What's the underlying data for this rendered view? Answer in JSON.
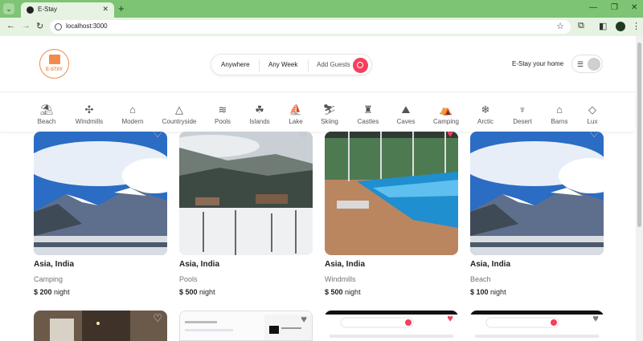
{
  "browser": {
    "tab_title": "E-Stay",
    "url": "localhost:3000"
  },
  "header": {
    "logo_text": "E-STAY",
    "search": {
      "anywhere": "Anywhere",
      "any_week": "Any Week",
      "add_guests": "Add Guests"
    },
    "host_link": "E-Stay your home"
  },
  "categories": [
    {
      "label": "Beach",
      "icon": "beach-icon"
    },
    {
      "label": "Windmills",
      "icon": "windmill-icon"
    },
    {
      "label": "Modern",
      "icon": "modern-house-icon"
    },
    {
      "label": "Countryside",
      "icon": "mountain-icon"
    },
    {
      "label": "Pools",
      "icon": "pool-icon"
    },
    {
      "label": "Islands",
      "icon": "island-icon"
    },
    {
      "label": "Lake",
      "icon": "sailboat-icon"
    },
    {
      "label": "Skiing",
      "icon": "skiing-icon"
    },
    {
      "label": "Castles",
      "icon": "castle-icon"
    },
    {
      "label": "Caves",
      "icon": "cave-icon"
    },
    {
      "label": "Camping",
      "icon": "tent-icon"
    },
    {
      "label": "Arctic",
      "icon": "snowflake-icon"
    },
    {
      "label": "Desert",
      "icon": "cactus-icon"
    },
    {
      "label": "Barns",
      "icon": "barn-icon"
    },
    {
      "label": "Lux",
      "icon": "diamond-icon"
    }
  ],
  "listings": [
    {
      "location": "Asia, India",
      "category": "Camping",
      "price": "$ 200",
      "unit": "night",
      "favorite": false
    },
    {
      "location": "Asia, India",
      "category": "Pools",
      "price": "$ 500",
      "unit": "night",
      "favorite": false
    },
    {
      "location": "Asia, India",
      "category": "Windmills",
      "price": "$ 500",
      "unit": "night",
      "favorite": true
    },
    {
      "location": "Asia, India",
      "category": "Beach",
      "price": "$ 100",
      "unit": "night",
      "favorite": false
    }
  ],
  "colors": {
    "accent": "#f43f5e",
    "brand": "#f08b4b",
    "browser_green": "#7dc474"
  }
}
